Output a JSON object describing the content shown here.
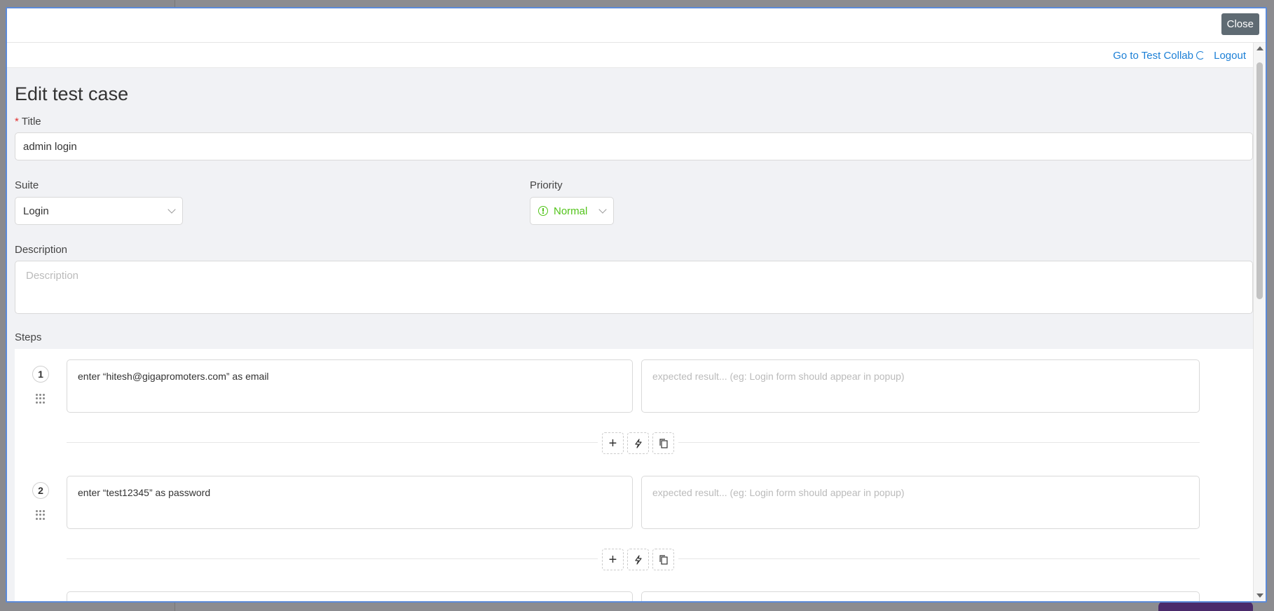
{
  "modal": {
    "close_label": "Close"
  },
  "topbar": {
    "test_collab_link": "Go to Test Collab",
    "logout_link": "Logout"
  },
  "form": {
    "page_title": "Edit test case",
    "title_label": "Title",
    "title_value": "admin login",
    "suite_label": "Suite",
    "suite_value": "Login",
    "priority_label": "Priority",
    "priority_value": "Normal",
    "description_label": "Description",
    "description_placeholder": "Description",
    "steps_label": "Steps"
  },
  "steps": [
    {
      "number": "1",
      "action": "enter “hitesh@gigapromoters.com” as email",
      "expected_placeholder": "expected result... (eg: Login form should appear in popup)"
    },
    {
      "number": "2",
      "action": "enter “test12345” as password",
      "expected_placeholder": "expected result... (eg: Login form should appear in popup)"
    }
  ],
  "colors": {
    "link": "#1b7fd6",
    "priority_normal": "#52c41a",
    "close_button": "#5f6b73",
    "required": "#e03030"
  },
  "icons": [
    "logout-icon",
    "info-icon",
    "chevron-down-icon",
    "drag-handle-icon",
    "plus-icon",
    "lightning-icon",
    "copy-icon"
  ]
}
